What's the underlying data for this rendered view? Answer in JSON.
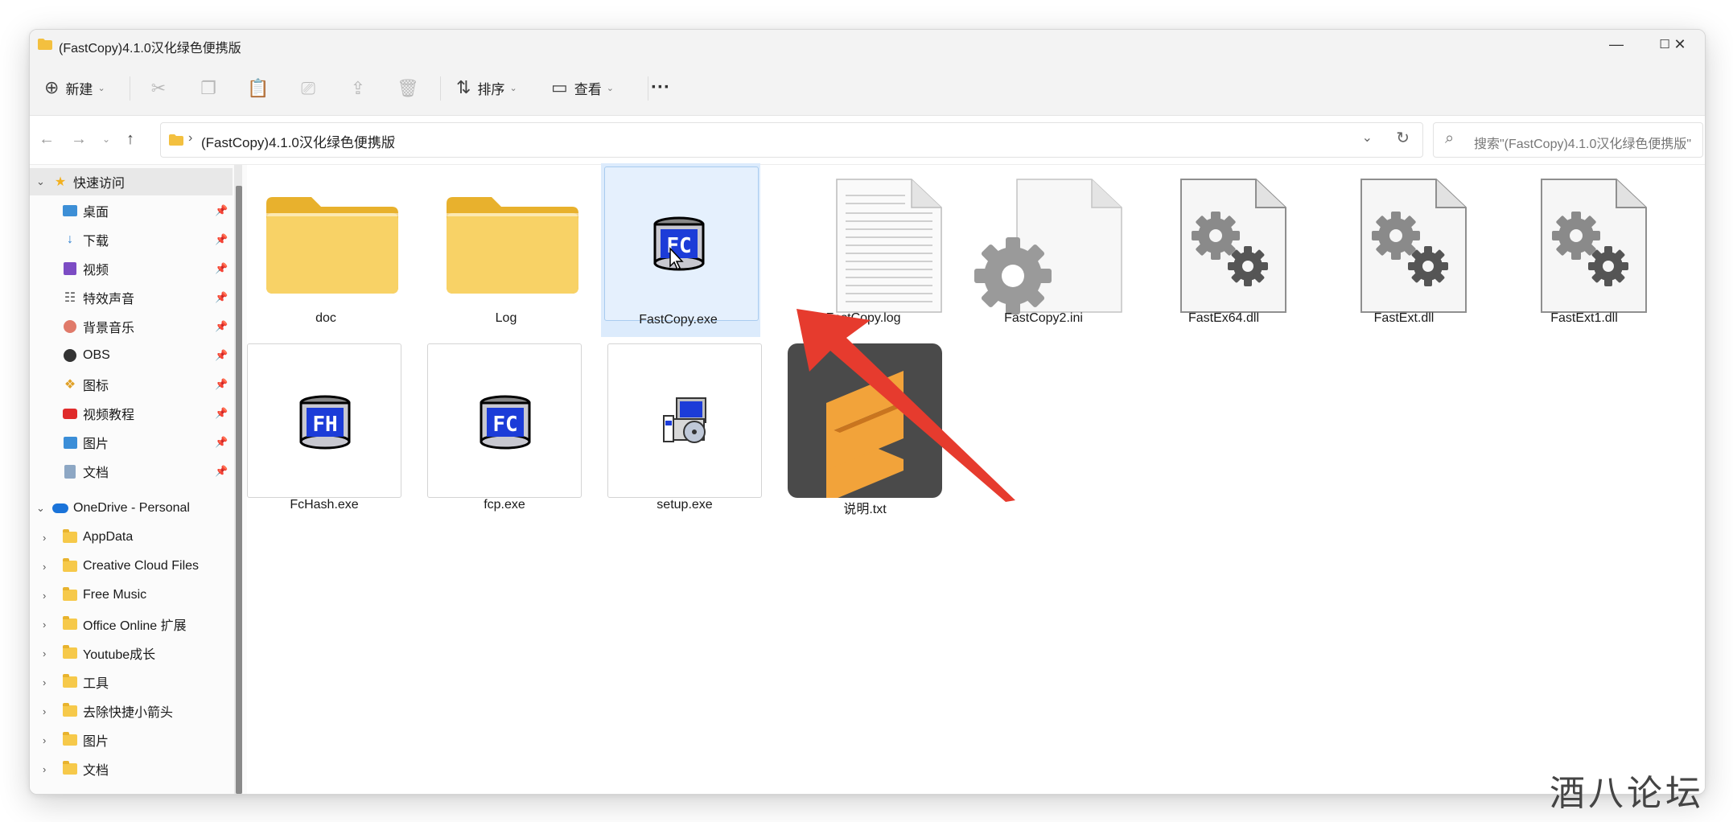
{
  "window": {
    "title": "(FastCopy)4.1.0汉化绿色便携版",
    "minimize": "—",
    "maximize": "☐",
    "close": "✕"
  },
  "toolbar": {
    "new_label": "新建",
    "sort_label": "排序",
    "view_label": "查看",
    "more_label": "···"
  },
  "address": {
    "path": "(FastCopy)4.1.0汉化绿色便携版",
    "search_placeholder": "搜索\"(FastCopy)4.1.0汉化绿色便携版\""
  },
  "sidebar": {
    "quick_access": "快速访问",
    "quick_items": [
      {
        "label": "桌面",
        "icon": "desktop-icon"
      },
      {
        "label": "下载",
        "icon": "download-icon"
      },
      {
        "label": "视频",
        "icon": "video-icon"
      },
      {
        "label": "特效声音",
        "icon": "sound-icon"
      },
      {
        "label": "背景音乐",
        "icon": "music-icon"
      },
      {
        "label": "OBS",
        "icon": "obs-icon"
      },
      {
        "label": "图标",
        "icon": "icons-icon"
      },
      {
        "label": "视频教程",
        "icon": "youtube-icon"
      },
      {
        "label": "图片",
        "icon": "picture-icon"
      },
      {
        "label": "文档",
        "icon": "document-icon"
      }
    ],
    "onedrive": "OneDrive - Personal",
    "onedrive_items": [
      {
        "label": "AppData"
      },
      {
        "label": "Creative Cloud Files"
      },
      {
        "label": "Free Music"
      },
      {
        "label": "Office Online 扩展"
      },
      {
        "label": "Youtube成长"
      },
      {
        "label": "工具"
      },
      {
        "label": "去除快捷小箭头"
      },
      {
        "label": "图片"
      },
      {
        "label": "文档"
      }
    ]
  },
  "files": [
    {
      "name": "doc",
      "type": "folder"
    },
    {
      "name": "Log",
      "type": "folder"
    },
    {
      "name": "FastCopy.exe",
      "type": "exe-fc",
      "selected": true
    },
    {
      "name": "FastCopy.log",
      "type": "text-file"
    },
    {
      "name": "FastCopy2.ini",
      "type": "ini-file"
    },
    {
      "name": "FastEx64.dll",
      "type": "dll-file"
    },
    {
      "name": "FastExt.dll",
      "type": "dll-file"
    },
    {
      "name": "FastExt1.dll",
      "type": "dll-file"
    },
    {
      "name": "FcHash.exe",
      "type": "exe-fh"
    },
    {
      "name": "fcp.exe",
      "type": "exe-fc"
    },
    {
      "name": "setup.exe",
      "type": "setup"
    },
    {
      "name": "说明.txt",
      "type": "sublime"
    }
  ],
  "icons": {
    "exe_fc_text": "FC",
    "exe_fh_text": "FH"
  },
  "colors": {
    "selection": "#dcebfc",
    "folder": "#f6c94a",
    "arrow": "#e63b2e"
  },
  "watermark": "酒八论坛"
}
